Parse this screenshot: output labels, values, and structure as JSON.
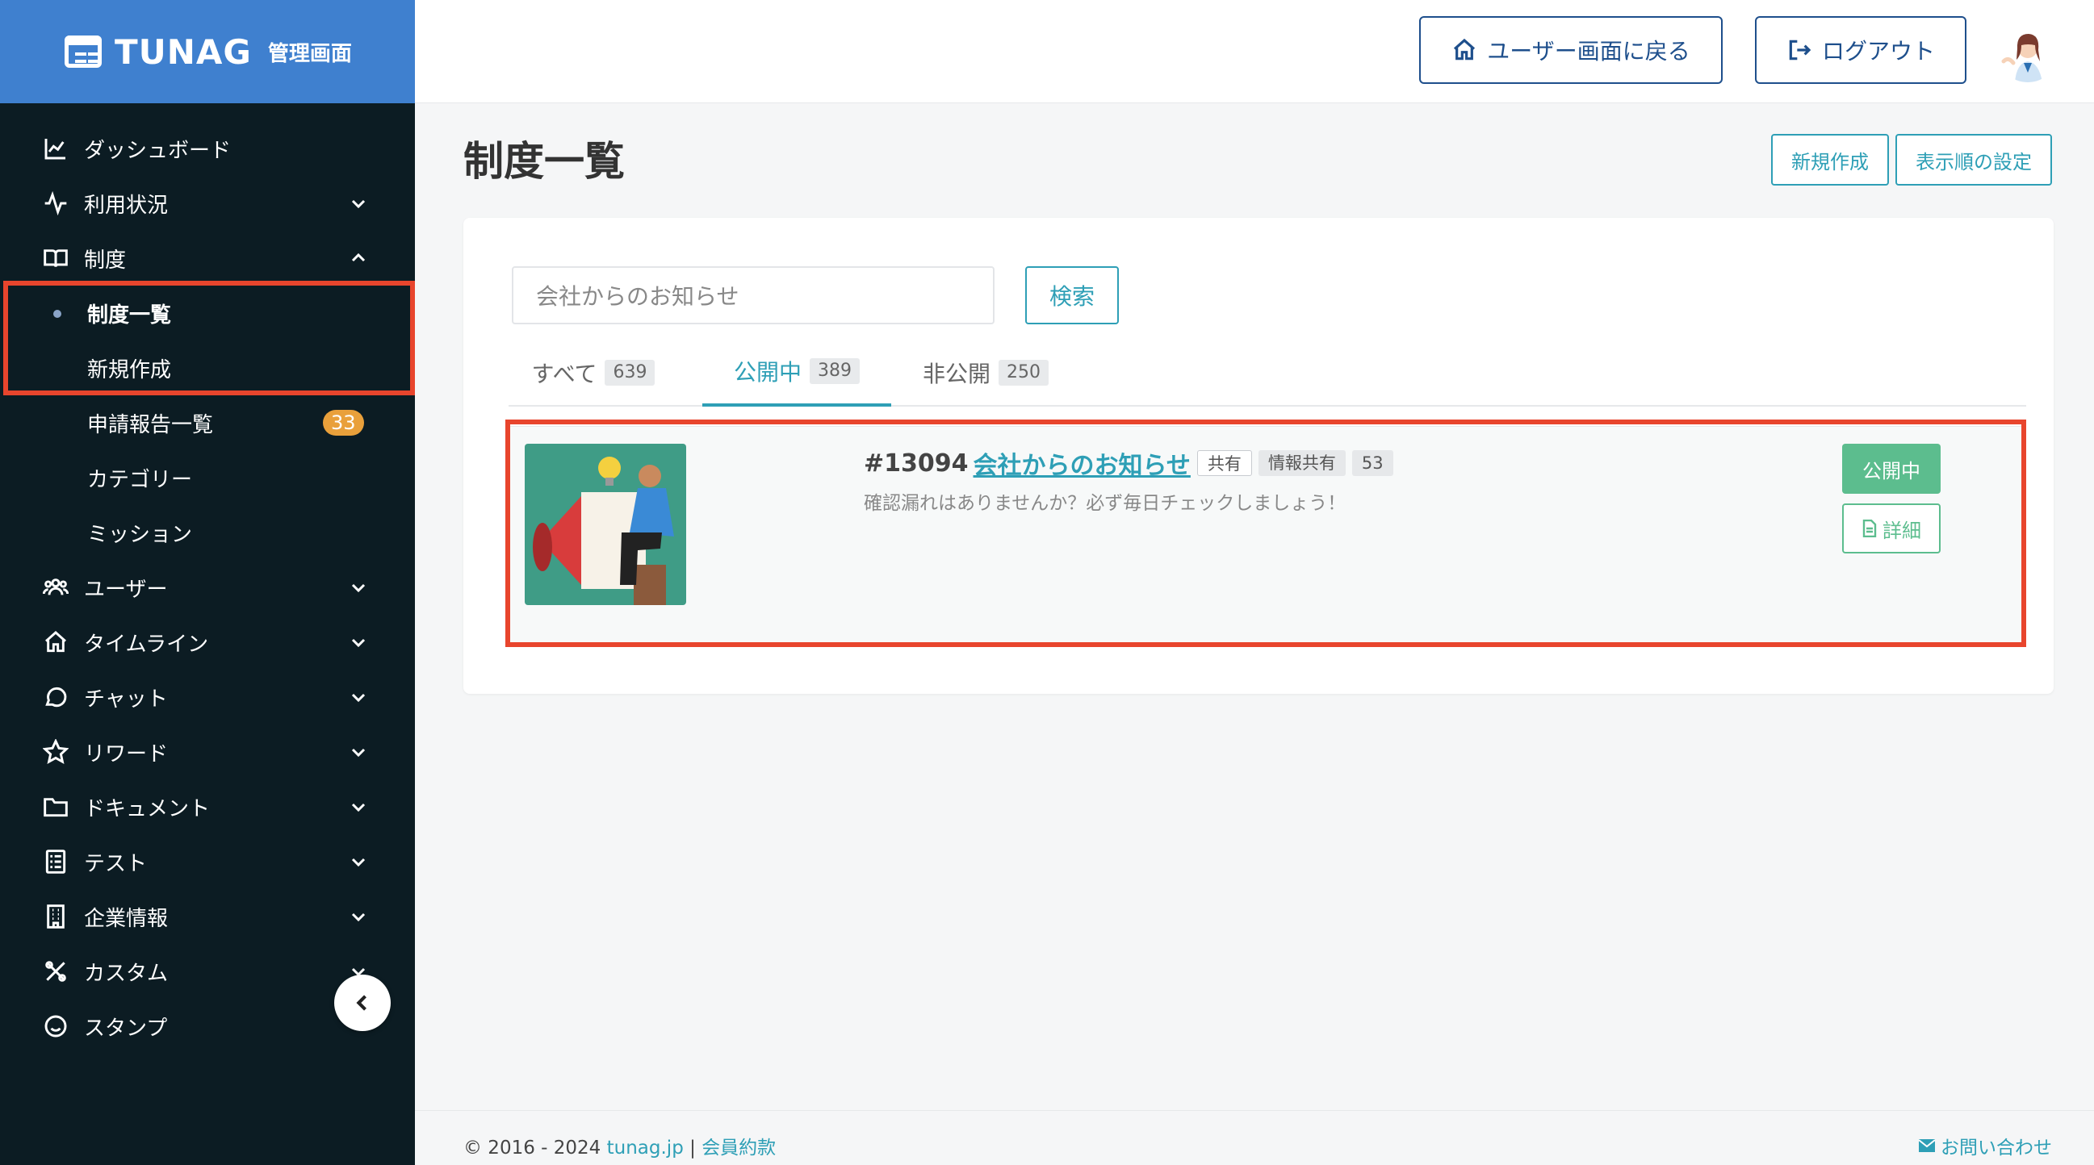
{
  "brand": {
    "name": "TUNAG",
    "sub": "管理画面"
  },
  "sidebar": {
    "items": [
      {
        "label": "ダッシュボード"
      },
      {
        "label": "利用状況"
      },
      {
        "label": "制度"
      },
      {
        "label": "ユーザー"
      },
      {
        "label": "タイムライン"
      },
      {
        "label": "チャット"
      },
      {
        "label": "リワード"
      },
      {
        "label": "ドキュメント"
      },
      {
        "label": "テスト"
      },
      {
        "label": "企業情報"
      },
      {
        "label": "カスタム"
      },
      {
        "label": "スタンプ"
      }
    ],
    "sub_items": [
      {
        "label": "制度一覧"
      },
      {
        "label": "新規作成"
      },
      {
        "label": "申請報告一覧",
        "badge": "33"
      },
      {
        "label": "カテゴリー"
      },
      {
        "label": "ミッション"
      }
    ]
  },
  "header": {
    "back_label": "ユーザー画面に戻る",
    "logout_label": "ログアウト"
  },
  "main": {
    "title": "制度一覧",
    "new_label": "新規作成",
    "order_label": "表示順の設定",
    "search": {
      "value": "会社からのお知らせ",
      "button": "検索"
    },
    "tabs": [
      {
        "label": "すべて",
        "count": "639"
      },
      {
        "label": "公開中",
        "count": "389"
      },
      {
        "label": "非公開",
        "count": "250"
      }
    ],
    "item": {
      "id": "#13094",
      "title": "会社からのお知らせ",
      "tag1": "共有",
      "tag2": "情報共有",
      "tag3": "53",
      "desc": "確認漏れはありませんか？必ず毎日チェックしましょう！",
      "status": "公開中",
      "detail": "詳細"
    }
  },
  "footer": {
    "copyright": "© 2016 - 2024 ",
    "site": "tunag.jp",
    "sep": " | ",
    "terms": "会員約款",
    "contact": "お問い合わせ"
  },
  "colors": {
    "brand": "#3f80cf",
    "sidebar": "#0c1c23",
    "accent": "#2e9fb6",
    "green": "#5cbd8e",
    "highlight": "#e8452d",
    "badge": "#e9a03b"
  }
}
